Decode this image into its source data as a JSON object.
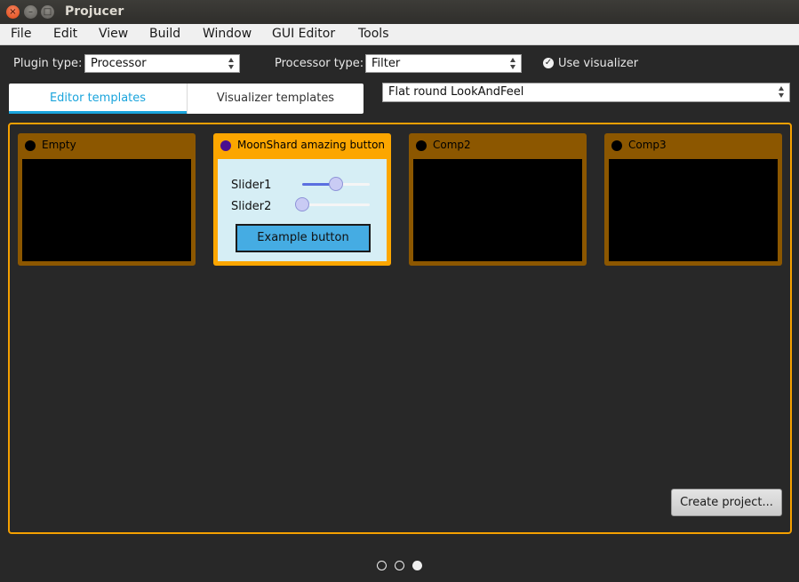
{
  "window": {
    "title": "Projucer",
    "close_glyph": "×",
    "min_glyph": "–",
    "max_glyph": "□"
  },
  "menu": [
    "File",
    "Edit",
    "View",
    "Build",
    "Window",
    "GUI Editor",
    "Tools"
  ],
  "options": {
    "plugin_type_label": "Plugin type:",
    "plugin_type_value": "Processor",
    "processor_type_label": "Processor type:",
    "processor_type_value": "Filter",
    "use_visualizer_label": "Use visualizer",
    "use_visualizer_checked": true
  },
  "tabs": [
    {
      "label": "Editor templates",
      "active": true
    },
    {
      "label": "Visualizer templates",
      "active": false
    }
  ],
  "lookandfeel_value": "Flat round LookAndFeel",
  "cards": [
    {
      "title": "Empty",
      "selected": false
    },
    {
      "title": "MoonShard amazing button",
      "selected": true,
      "slider1_label": "Slider1",
      "slider1_value": 0.5,
      "slider2_label": "Slider2",
      "slider2_value": 0.0,
      "button_label": "Example button"
    },
    {
      "title": "Comp2",
      "selected": false
    },
    {
      "title": "Comp3",
      "selected": false
    }
  ],
  "create_button_label": "Create project...",
  "pager": {
    "count": 3,
    "current": 3
  },
  "colors": {
    "accent": "#1aa4dc",
    "panel_border": "#f5a000",
    "card": "#8c5700",
    "card_selected": "#fca600",
    "slider_fill": "#5b6fe0",
    "example_button": "#45ace3"
  }
}
